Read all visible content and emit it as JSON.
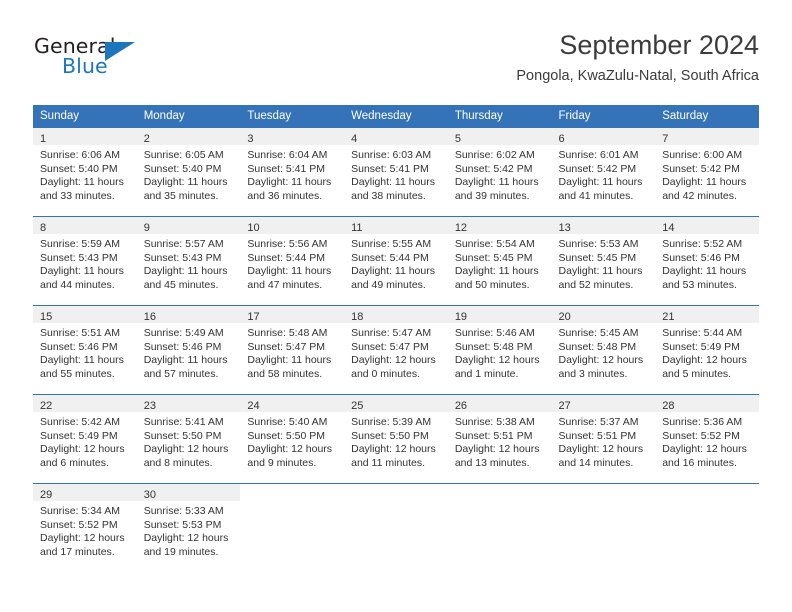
{
  "brand": {
    "name_part1": "General",
    "name_part2": "Blue",
    "logo_icon": "triangle-logo-icon",
    "accent_color": "#1d76bb"
  },
  "header": {
    "month_title": "September 2024",
    "location": "Pongola, KwaZulu-Natal, South Africa"
  },
  "theme": {
    "header_bg": "#3573b9",
    "daynum_bg": "#f0f0f0",
    "text": "#333333"
  },
  "calendar": {
    "weekday_headers": [
      "Sunday",
      "Monday",
      "Tuesday",
      "Wednesday",
      "Thursday",
      "Friday",
      "Saturday"
    ],
    "weeks": [
      [
        {
          "day": "1",
          "sunrise": "Sunrise: 6:06 AM",
          "sunset": "Sunset: 5:40 PM",
          "daylight_line1": "Daylight: 11 hours",
          "daylight_line2": "and 33 minutes."
        },
        {
          "day": "2",
          "sunrise": "Sunrise: 6:05 AM",
          "sunset": "Sunset: 5:40 PM",
          "daylight_line1": "Daylight: 11 hours",
          "daylight_line2": "and 35 minutes."
        },
        {
          "day": "3",
          "sunrise": "Sunrise: 6:04 AM",
          "sunset": "Sunset: 5:41 PM",
          "daylight_line1": "Daylight: 11 hours",
          "daylight_line2": "and 36 minutes."
        },
        {
          "day": "4",
          "sunrise": "Sunrise: 6:03 AM",
          "sunset": "Sunset: 5:41 PM",
          "daylight_line1": "Daylight: 11 hours",
          "daylight_line2": "and 38 minutes."
        },
        {
          "day": "5",
          "sunrise": "Sunrise: 6:02 AM",
          "sunset": "Sunset: 5:42 PM",
          "daylight_line1": "Daylight: 11 hours",
          "daylight_line2": "and 39 minutes."
        },
        {
          "day": "6",
          "sunrise": "Sunrise: 6:01 AM",
          "sunset": "Sunset: 5:42 PM",
          "daylight_line1": "Daylight: 11 hours",
          "daylight_line2": "and 41 minutes."
        },
        {
          "day": "7",
          "sunrise": "Sunrise: 6:00 AM",
          "sunset": "Sunset: 5:42 PM",
          "daylight_line1": "Daylight: 11 hours",
          "daylight_line2": "and 42 minutes."
        }
      ],
      [
        {
          "day": "8",
          "sunrise": "Sunrise: 5:59 AM",
          "sunset": "Sunset: 5:43 PM",
          "daylight_line1": "Daylight: 11 hours",
          "daylight_line2": "and 44 minutes."
        },
        {
          "day": "9",
          "sunrise": "Sunrise: 5:57 AM",
          "sunset": "Sunset: 5:43 PM",
          "daylight_line1": "Daylight: 11 hours",
          "daylight_line2": "and 45 minutes."
        },
        {
          "day": "10",
          "sunrise": "Sunrise: 5:56 AM",
          "sunset": "Sunset: 5:44 PM",
          "daylight_line1": "Daylight: 11 hours",
          "daylight_line2": "and 47 minutes."
        },
        {
          "day": "11",
          "sunrise": "Sunrise: 5:55 AM",
          "sunset": "Sunset: 5:44 PM",
          "daylight_line1": "Daylight: 11 hours",
          "daylight_line2": "and 49 minutes."
        },
        {
          "day": "12",
          "sunrise": "Sunrise: 5:54 AM",
          "sunset": "Sunset: 5:45 PM",
          "daylight_line1": "Daylight: 11 hours",
          "daylight_line2": "and 50 minutes."
        },
        {
          "day": "13",
          "sunrise": "Sunrise: 5:53 AM",
          "sunset": "Sunset: 5:45 PM",
          "daylight_line1": "Daylight: 11 hours",
          "daylight_line2": "and 52 minutes."
        },
        {
          "day": "14",
          "sunrise": "Sunrise: 5:52 AM",
          "sunset": "Sunset: 5:46 PM",
          "daylight_line1": "Daylight: 11 hours",
          "daylight_line2": "and 53 minutes."
        }
      ],
      [
        {
          "day": "15",
          "sunrise": "Sunrise: 5:51 AM",
          "sunset": "Sunset: 5:46 PM",
          "daylight_line1": "Daylight: 11 hours",
          "daylight_line2": "and 55 minutes."
        },
        {
          "day": "16",
          "sunrise": "Sunrise: 5:49 AM",
          "sunset": "Sunset: 5:46 PM",
          "daylight_line1": "Daylight: 11 hours",
          "daylight_line2": "and 57 minutes."
        },
        {
          "day": "17",
          "sunrise": "Sunrise: 5:48 AM",
          "sunset": "Sunset: 5:47 PM",
          "daylight_line1": "Daylight: 11 hours",
          "daylight_line2": "and 58 minutes."
        },
        {
          "day": "18",
          "sunrise": "Sunrise: 5:47 AM",
          "sunset": "Sunset: 5:47 PM",
          "daylight_line1": "Daylight: 12 hours",
          "daylight_line2": "and 0 minutes."
        },
        {
          "day": "19",
          "sunrise": "Sunrise: 5:46 AM",
          "sunset": "Sunset: 5:48 PM",
          "daylight_line1": "Daylight: 12 hours",
          "daylight_line2": "and 1 minute."
        },
        {
          "day": "20",
          "sunrise": "Sunrise: 5:45 AM",
          "sunset": "Sunset: 5:48 PM",
          "daylight_line1": "Daylight: 12 hours",
          "daylight_line2": "and 3 minutes."
        },
        {
          "day": "21",
          "sunrise": "Sunrise: 5:44 AM",
          "sunset": "Sunset: 5:49 PM",
          "daylight_line1": "Daylight: 12 hours",
          "daylight_line2": "and 5 minutes."
        }
      ],
      [
        {
          "day": "22",
          "sunrise": "Sunrise: 5:42 AM",
          "sunset": "Sunset: 5:49 PM",
          "daylight_line1": "Daylight: 12 hours",
          "daylight_line2": "and 6 minutes."
        },
        {
          "day": "23",
          "sunrise": "Sunrise: 5:41 AM",
          "sunset": "Sunset: 5:50 PM",
          "daylight_line1": "Daylight: 12 hours",
          "daylight_line2": "and 8 minutes."
        },
        {
          "day": "24",
          "sunrise": "Sunrise: 5:40 AM",
          "sunset": "Sunset: 5:50 PM",
          "daylight_line1": "Daylight: 12 hours",
          "daylight_line2": "and 9 minutes."
        },
        {
          "day": "25",
          "sunrise": "Sunrise: 5:39 AM",
          "sunset": "Sunset: 5:50 PM",
          "daylight_line1": "Daylight: 12 hours",
          "daylight_line2": "and 11 minutes."
        },
        {
          "day": "26",
          "sunrise": "Sunrise: 5:38 AM",
          "sunset": "Sunset: 5:51 PM",
          "daylight_line1": "Daylight: 12 hours",
          "daylight_line2": "and 13 minutes."
        },
        {
          "day": "27",
          "sunrise": "Sunrise: 5:37 AM",
          "sunset": "Sunset: 5:51 PM",
          "daylight_line1": "Daylight: 12 hours",
          "daylight_line2": "and 14 minutes."
        },
        {
          "day": "28",
          "sunrise": "Sunrise: 5:36 AM",
          "sunset": "Sunset: 5:52 PM",
          "daylight_line1": "Daylight: 12 hours",
          "daylight_line2": "and 16 minutes."
        }
      ],
      [
        {
          "day": "29",
          "sunrise": "Sunrise: 5:34 AM",
          "sunset": "Sunset: 5:52 PM",
          "daylight_line1": "Daylight: 12 hours",
          "daylight_line2": "and 17 minutes."
        },
        {
          "day": "30",
          "sunrise": "Sunrise: 5:33 AM",
          "sunset": "Sunset: 5:53 PM",
          "daylight_line1": "Daylight: 12 hours",
          "daylight_line2": "and 19 minutes."
        },
        {
          "day": "",
          "sunrise": "",
          "sunset": "",
          "daylight_line1": "",
          "daylight_line2": ""
        },
        {
          "day": "",
          "sunrise": "",
          "sunset": "",
          "daylight_line1": "",
          "daylight_line2": ""
        },
        {
          "day": "",
          "sunrise": "",
          "sunset": "",
          "daylight_line1": "",
          "daylight_line2": ""
        },
        {
          "day": "",
          "sunrise": "",
          "sunset": "",
          "daylight_line1": "",
          "daylight_line2": ""
        },
        {
          "day": "",
          "sunrise": "",
          "sunset": "",
          "daylight_line1": "",
          "daylight_line2": ""
        }
      ]
    ]
  }
}
